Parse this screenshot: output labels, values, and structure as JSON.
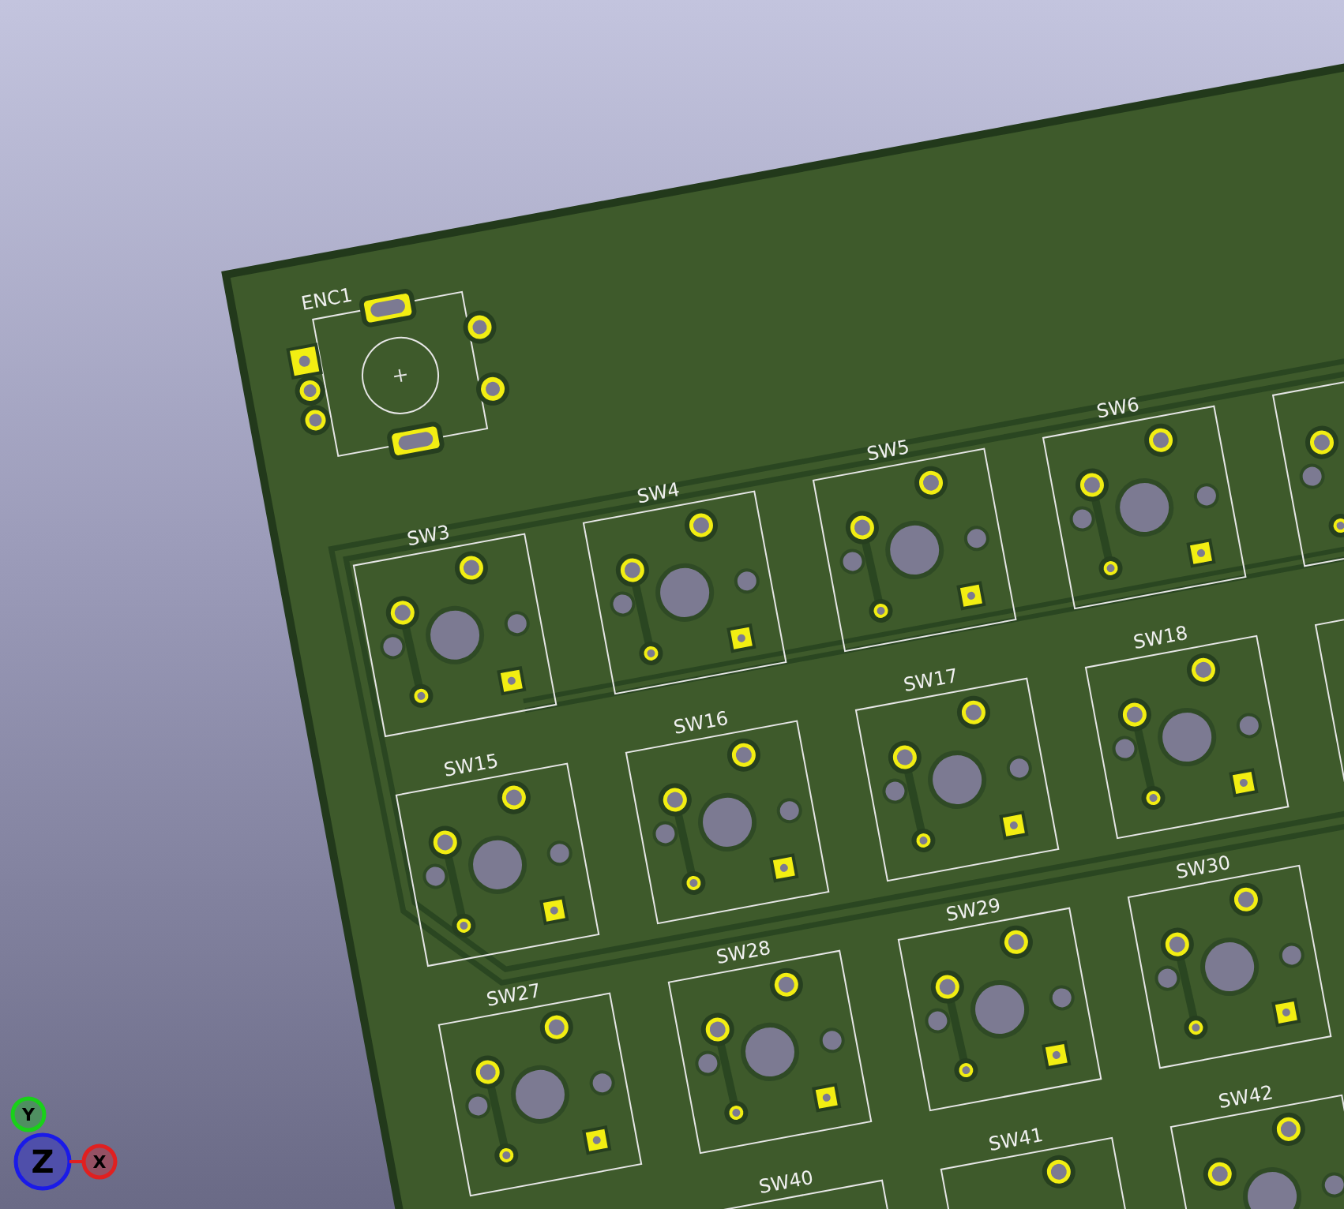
{
  "board": {
    "encoder": {
      "ref": "ENC1"
    },
    "switch_rows": [
      {
        "switches": [
          {
            "ref": "SW3"
          },
          {
            "ref": "SW4"
          },
          {
            "ref": "SW5"
          },
          {
            "ref": "SW6"
          }
        ]
      },
      {
        "switches": [
          {
            "ref": "SW15"
          },
          {
            "ref": "SW16"
          },
          {
            "ref": "SW17"
          },
          {
            "ref": "SW18"
          }
        ]
      },
      {
        "switches": [
          {
            "ref": "SW27"
          },
          {
            "ref": "SW28"
          },
          {
            "ref": "SW29"
          },
          {
            "ref": "SW30"
          }
        ]
      },
      {
        "switches": [
          {
            "ref": "SW40"
          },
          {
            "ref": "SW41"
          },
          {
            "ref": "SW42"
          }
        ]
      }
    ]
  },
  "axes": [
    {
      "label": "Y",
      "color": "#19d119"
    },
    {
      "label": "Z",
      "color": "#1a1ae8"
    },
    {
      "label": "X",
      "color": "#e02020"
    }
  ]
}
